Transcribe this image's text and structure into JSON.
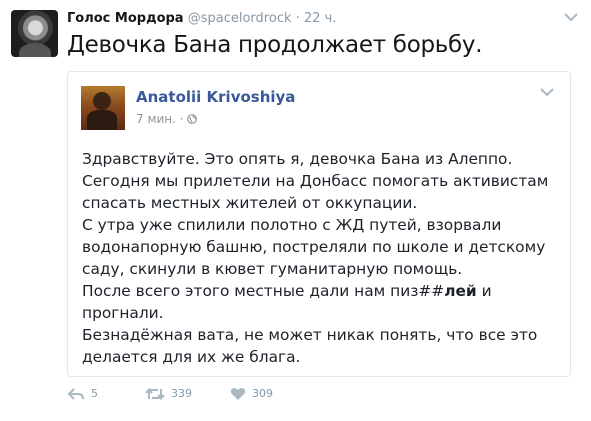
{
  "tweet": {
    "author_name": "Голос Мордора",
    "author_handle": "@spacelordrock",
    "separator": "·",
    "time": "22 ч.",
    "text": "Девочка Бана продолжает борьбу."
  },
  "embedded_post": {
    "author_name": "Anatolii Krivoshiya",
    "time": "7 мин.",
    "separator": "·",
    "privacy_icon": "globe-icon",
    "lines": [
      "Здравствуйте. Это опять я, девочка Бана из Алеппо.",
      "Сегодня мы прилетели на Донбасс помогать активистам",
      "спасать местных жителей от оккупации.",
      "С утра уже спилили полотно с ЖД путей, взорвали",
      "водонапорную башню, постреляли по школе и детскому",
      "саду, скинули в кювет гуманитарную помощь."
    ],
    "line7_prefix": "После всего этого местные дали нам пиз##",
    "line7_bold": "лей",
    "line7_suffix": " и",
    "lines_after": [
      "прогнали.",
      "Безнадёжная вата, не может никак понять, что все это",
      "делается для их же блага."
    ]
  },
  "actions": {
    "reply_count": "5",
    "retweet_count": "339",
    "like_count": "309"
  },
  "colors": {
    "link_blue": "#3b5998",
    "muted": "#8899a6",
    "border": "#e1e8ed"
  }
}
